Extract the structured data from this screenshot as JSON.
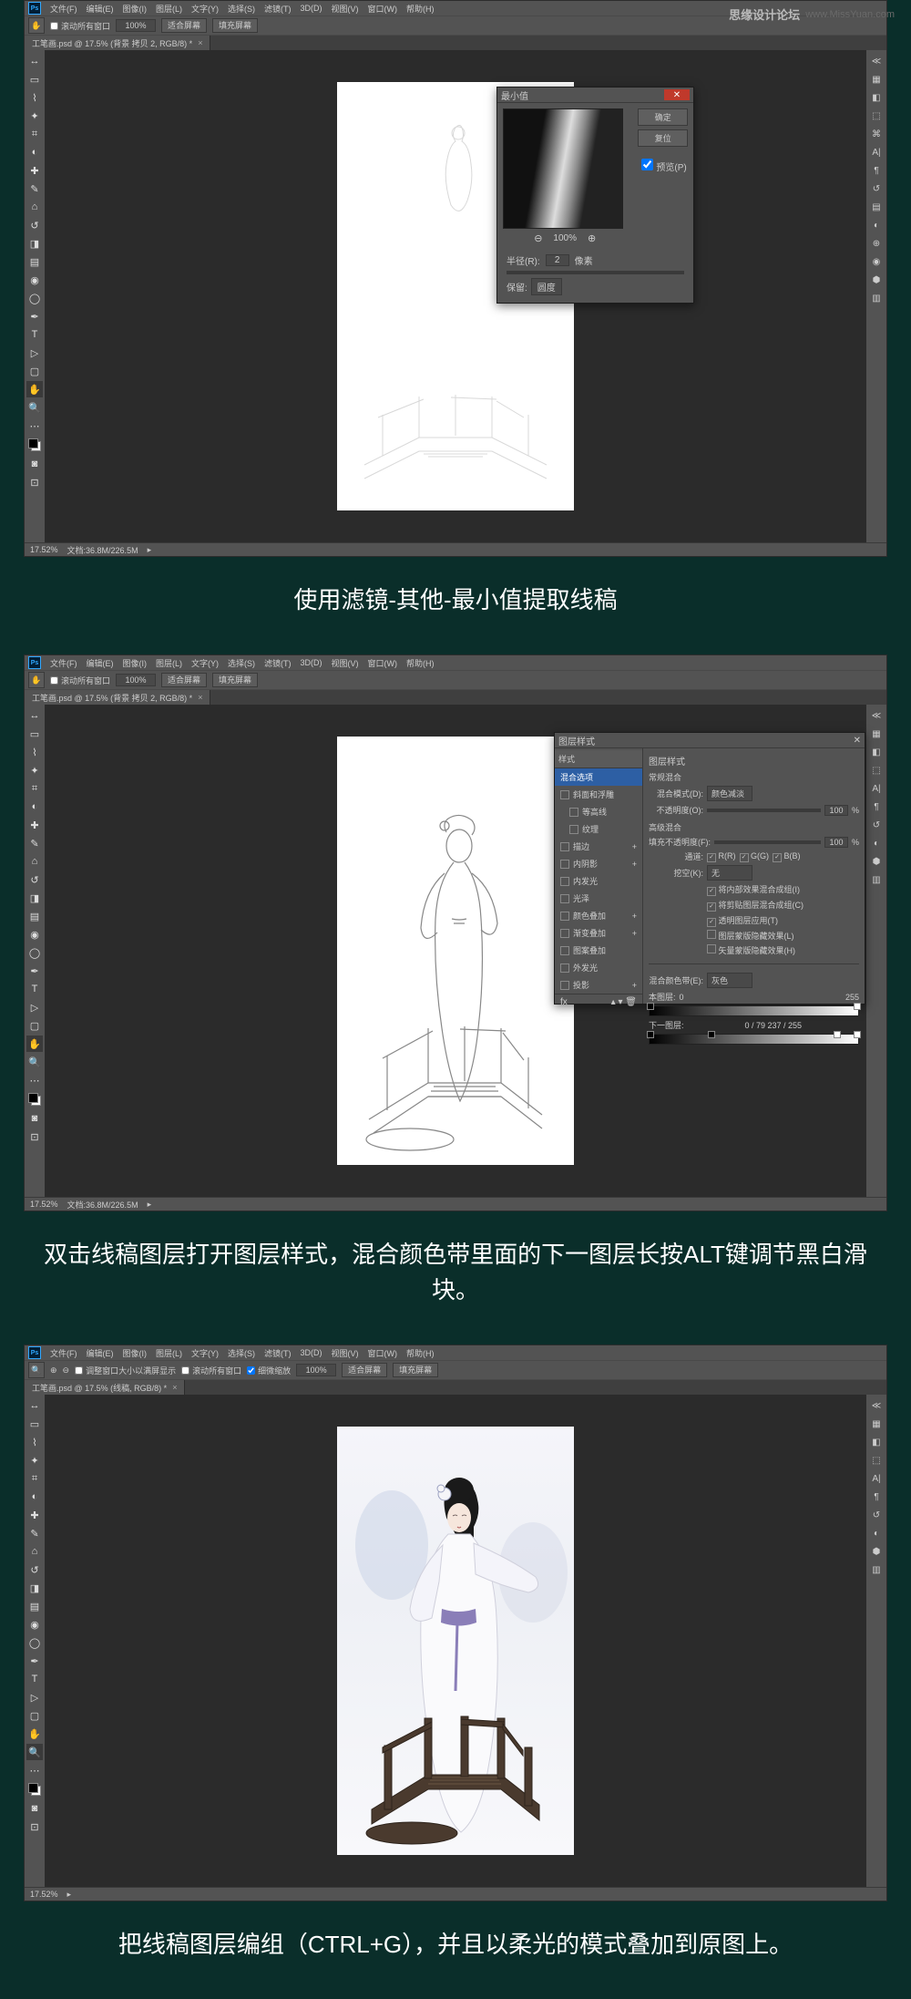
{
  "watermark": {
    "label": "思缘设计论坛",
    "url": "www.MissYuan.com"
  },
  "menu": {
    "file": "文件(F)",
    "edit": "编辑(E)",
    "image": "图像(I)",
    "layer": "图层(L)",
    "type": "文字(Y)",
    "select": "选择(S)",
    "filter": "滤镜(T)",
    "d3": "3D(D)",
    "view": "视图(V)",
    "window": "窗口(W)",
    "help": "帮助(H)"
  },
  "options1": {
    "scroll": "滚动所有窗口",
    "zoom": "100%",
    "fit": "适合屏幕",
    "fill": "填充屏幕"
  },
  "options3": {
    "resize": "调整窗口大小以满屏显示",
    "scroll": "滚动所有窗口",
    "scrub": "细微缩放",
    "zoom": "100%",
    "fit": "适合屏幕",
    "fill": "填充屏幕"
  },
  "tab1": "工笔画.psd @ 17.5% (背景 拷贝 2, RGB/8) *",
  "tab3": "工笔画.psd @ 17.5% (线稿, RGB/8) *",
  "status": {
    "zoom": "17.52%",
    "doc": "文档:36.8M/226.5M"
  },
  "caption1": "使用滤镜-其他-最小值提取线稿",
  "caption2": "双击线稿图层打开图层样式，混合颜色带里面的下一图层长按ALT键调节黑白滑块。",
  "caption3": "把线稿图层编组（CTRL+G），并且以柔光的模式叠加到原图上。",
  "min_dialog": {
    "title": "最小值",
    "ok": "确定",
    "cancel": "复位",
    "preview": "预览(P)",
    "zoom": "100%",
    "radius_label": "半径(R):",
    "radius_value": "2",
    "radius_unit": "像素",
    "preserve_label": "保留:",
    "preserve_value": "圆度"
  },
  "ls_dialog": {
    "title": "图层样式",
    "styles_head": "样式",
    "left_items": {
      "blendopt": "混合选项",
      "bevel": "斜面和浮雕",
      "contour": "等高线",
      "texture": "纹理",
      "stroke": "描边",
      "innershadow": "内阴影",
      "innerglow": "内发光",
      "satin": "光泽",
      "coloroverlay": "颜色叠加",
      "gradoverlay": "渐变叠加",
      "patternoverlay": "图案叠加",
      "outerglow": "外发光",
      "dropshadow": "投影"
    },
    "section_general": "常规混合",
    "blendmode_label": "混合模式(D):",
    "blendmode_value": "颜色减淡",
    "opacity_label": "不透明度(O):",
    "opacity_value": "100",
    "section_advanced": "高级混合",
    "fill_label": "填充不透明度(F):",
    "fill_value": "100",
    "channels_label": "通道:",
    "ch_r": "R(R)",
    "ch_g": "G(G)",
    "ch_b": "B(B)",
    "knockout_label": "挖空(K):",
    "knockout_value": "无",
    "cb1": "将内部效果混合成组(I)",
    "cb2": "将剪贴图层混合成组(C)",
    "cb3": "透明图层应用(T)",
    "cb4": "图层蒙版隐藏效果(L)",
    "cb5": "矢量蒙版隐藏效果(H)",
    "blendif_label": "混合颜色带(E):",
    "blendif_value": "灰色",
    "this_layer": "本图层:",
    "this_from": "0",
    "this_to": "255",
    "under_layer": "下一图层:",
    "under_vals": "0 / 79   237 / 255",
    "fx_label": "fx"
  }
}
